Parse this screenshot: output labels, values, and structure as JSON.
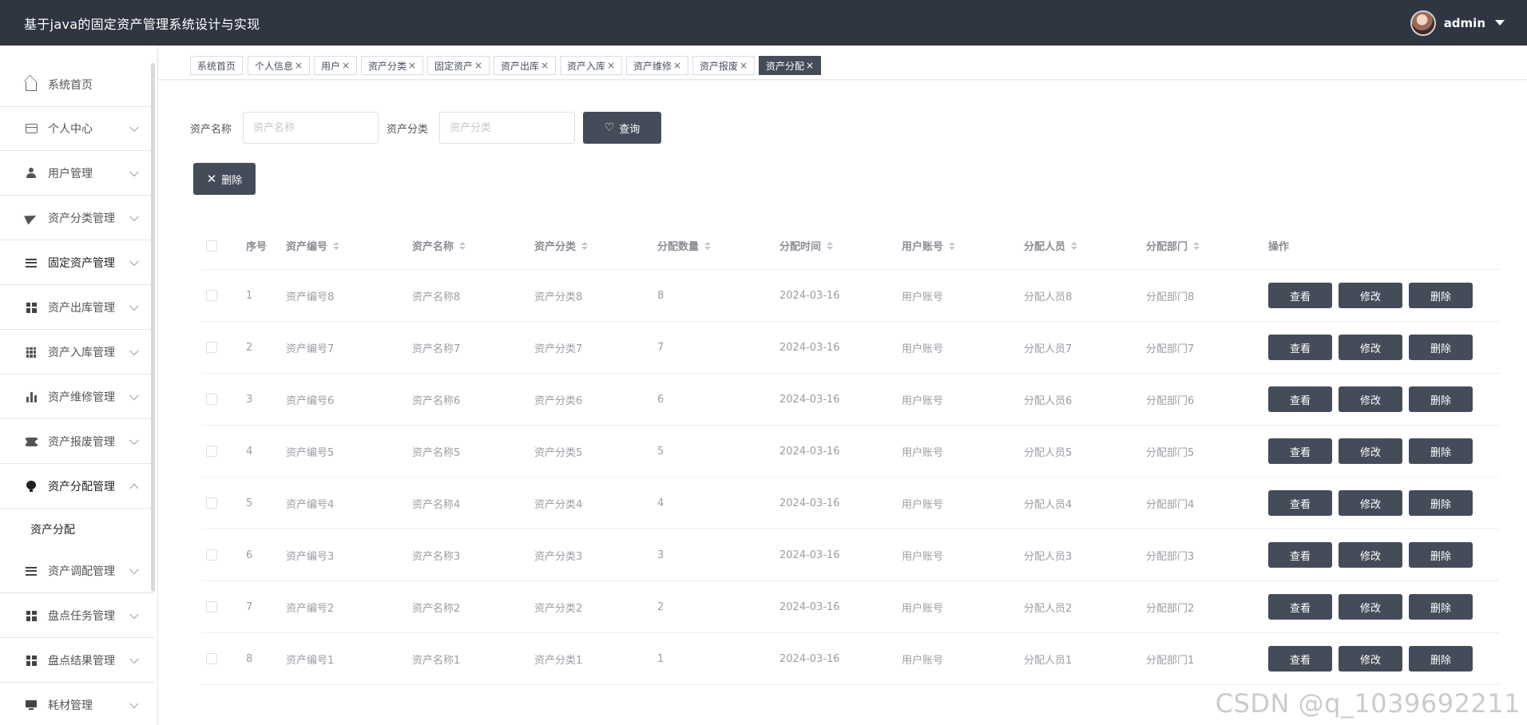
{
  "header": {
    "title": "基于java的固定资产管理系统设计与实现",
    "username": "admin"
  },
  "sidebar": {
    "items": [
      {
        "label": "系统首页",
        "icon": "home-icon"
      },
      {
        "label": "个人中心",
        "icon": "card-icon"
      },
      {
        "label": "用户管理",
        "icon": "user-icon"
      },
      {
        "label": "资产分类管理",
        "icon": "send-icon"
      },
      {
        "label": "固定资产管理",
        "icon": "list-icon"
      },
      {
        "label": "资产出库管理",
        "icon": "grid-icon"
      },
      {
        "label": "资产入库管理",
        "icon": "apps-icon"
      },
      {
        "label": "资产维修管理",
        "icon": "bar-chart-icon"
      },
      {
        "label": "资产报废管理",
        "icon": "ticket-icon"
      },
      {
        "label": "资产分配管理",
        "icon": "bulb-icon"
      },
      {
        "label": "资产调配管理",
        "icon": "list-icon"
      },
      {
        "label": "盘点任务管理",
        "icon": "grid-icon"
      },
      {
        "label": "盘点结果管理",
        "icon": "grid-icon"
      },
      {
        "label": "耗材管理",
        "icon": "monitor-icon"
      }
    ],
    "submenu": {
      "label": "资产分配"
    }
  },
  "tabs": [
    {
      "label": "系统首页"
    },
    {
      "label": "个人信息",
      "close": "×"
    },
    {
      "label": "用户",
      "close": "×"
    },
    {
      "label": "资产分类",
      "close": "×"
    },
    {
      "label": "固定资产",
      "close": "×"
    },
    {
      "label": "资产出库",
      "close": "×"
    },
    {
      "label": "资产入库",
      "close": "×"
    },
    {
      "label": "资产维修",
      "close": "×"
    },
    {
      "label": "资产报废",
      "close": "×"
    },
    {
      "label": "资产分配",
      "close": "×"
    }
  ],
  "search": {
    "name_label": "资产名称",
    "name_placeholder": "资产名称",
    "category_label": "资产分类",
    "category_placeholder": "资产分类",
    "query_button": "查询"
  },
  "toolbar": {
    "delete_button": "删除"
  },
  "table": {
    "headers": [
      "序号",
      "资产编号",
      "资产名称",
      "资产分类",
      "分配数量",
      "分配时间",
      "用户账号",
      "分配人员",
      "分配部门",
      "操作"
    ],
    "row_actions": [
      "查看",
      "修改",
      "删除"
    ],
    "rows": [
      [
        "1",
        "资产编号8",
        "资产名称8",
        "资产分类8",
        "8",
        "2024-03-16",
        "用户账号",
        "分配人员8",
        "分配部门8"
      ],
      [
        "2",
        "资产编号7",
        "资产名称7",
        "资产分类7",
        "7",
        "2024-03-16",
        "用户账号",
        "分配人员7",
        "分配部门7"
      ],
      [
        "3",
        "资产编号6",
        "资产名称6",
        "资产分类6",
        "6",
        "2024-03-16",
        "用户账号",
        "分配人员6",
        "分配部门6"
      ],
      [
        "4",
        "资产编号5",
        "资产名称5",
        "资产分类5",
        "5",
        "2024-03-16",
        "用户账号",
        "分配人员5",
        "分配部门5"
      ],
      [
        "5",
        "资产编号4",
        "资产名称4",
        "资产分类4",
        "4",
        "2024-03-16",
        "用户账号",
        "分配人员4",
        "分配部门4"
      ],
      [
        "6",
        "资产编号3",
        "资产名称3",
        "资产分类3",
        "3",
        "2024-03-16",
        "用户账号",
        "分配人员3",
        "分配部门3"
      ],
      [
        "7",
        "资产编号2",
        "资产名称2",
        "资产分类2",
        "2",
        "2024-03-16",
        "用户账号",
        "分配人员2",
        "分配部门2"
      ],
      [
        "8",
        "资产编号1",
        "资产名称1",
        "资产分类1",
        "1",
        "2024-03-16",
        "用户账号",
        "分配人员1",
        "分配部门1"
      ]
    ]
  },
  "watermark": "CSDN @q_1039692211",
  "colors": {
    "header_bg": "#2f3541",
    "button_bg": "#454c59"
  }
}
